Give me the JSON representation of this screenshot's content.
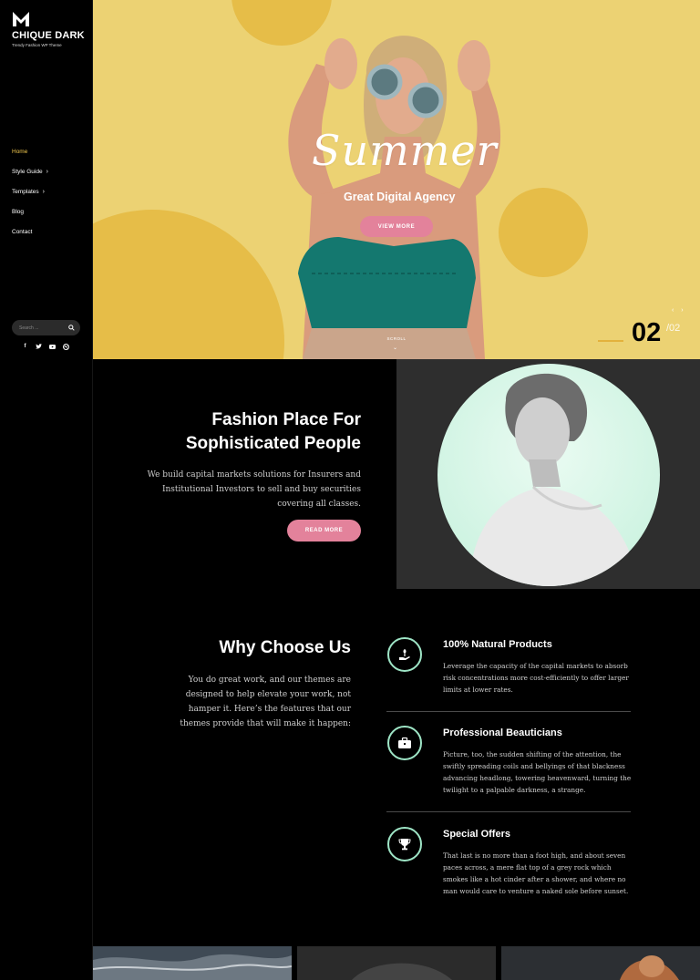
{
  "brand": {
    "name": "CHIQUE DARK",
    "tagline": "Trendy Fashion WP Theme"
  },
  "nav": [
    {
      "label": "Home",
      "has_sub": false
    },
    {
      "label": "Style Guide",
      "has_sub": true
    },
    {
      "label": "Templates",
      "has_sub": true
    },
    {
      "label": "Blog",
      "has_sub": false
    },
    {
      "label": "Contact",
      "has_sub": false
    }
  ],
  "search": {
    "placeholder": "Search ..."
  },
  "social": [
    "facebook-icon",
    "twitter-icon",
    "youtube-icon",
    "dribbble-icon"
  ],
  "hero": {
    "headline": "Summer",
    "subtitle": "Great Digital Agency",
    "button": "VIEW MORE",
    "scroll": "SCROLL",
    "slide_current": "02",
    "slide_total": "/02",
    "arrows": "‹ ›"
  },
  "fashion": {
    "title_line1": "Fashion Place For",
    "title_line2": "Sophisticated People",
    "text": "We build capital markets solutions for Insurers and Institutional Investors to sell and buy securities covering all classes.",
    "button": "READ MORE"
  },
  "why": {
    "title": "Why Choose Us",
    "text": "You do great work, and our themes are designed to help elevate your work, not hamper it. Here’s the features that our themes provide that will make it happen:"
  },
  "features": [
    {
      "title": "100% Natural Products",
      "text": "Leverage the capacity of the capital markets to absorb risk concentrations more cost-efficiently to offer larger limits at lower rates.",
      "icon": "plant-hand-icon"
    },
    {
      "title": "Professional Beauticians",
      "text": "Picture, too, the sudden shifting of the attention, the swiftly spreading coils and bellyings of that blackness advancing headlong, towering heavenward, turning the twilight to a palpable darkness, a strange.",
      "icon": "briefcase-icon"
    },
    {
      "title": "Special Offers",
      "text": "That last is no more than a foot high, and about seven paces across, a mere flat top of a grey rock which smokes like a hot cinder after a shower, and where no man would care to venture a naked sole before sunset.",
      "icon": "trophy-icon"
    }
  ],
  "colors": {
    "accent_pink": "#e3829b",
    "hero_yellow": "#ecd273",
    "mint": "#9ee5c6"
  }
}
